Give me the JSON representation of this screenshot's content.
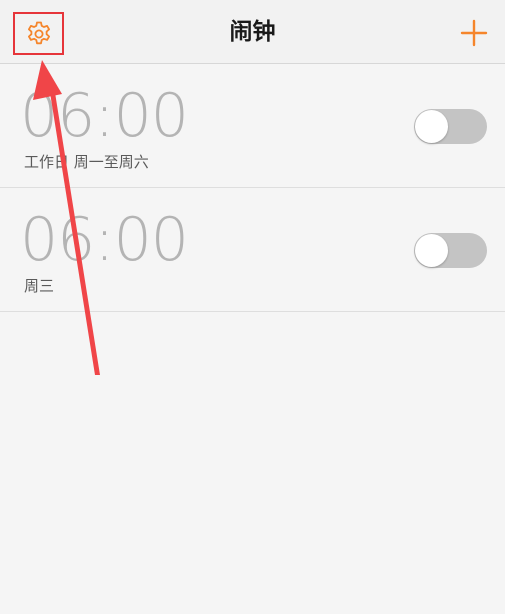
{
  "header": {
    "title": "闹钟",
    "settings_icon": "gear-icon",
    "add_icon": "plus-icon"
  },
  "alarms": [
    {
      "time": "06:00",
      "repeat": "工作日 周一至周六",
      "enabled": false
    },
    {
      "time": "06:00",
      "repeat": "周三",
      "enabled": false
    }
  ],
  "colors": {
    "accent": "#f5852b",
    "highlight_box": "#e6353a",
    "arrow": "#f04548",
    "toggle_off": "#c4c4c4"
  }
}
